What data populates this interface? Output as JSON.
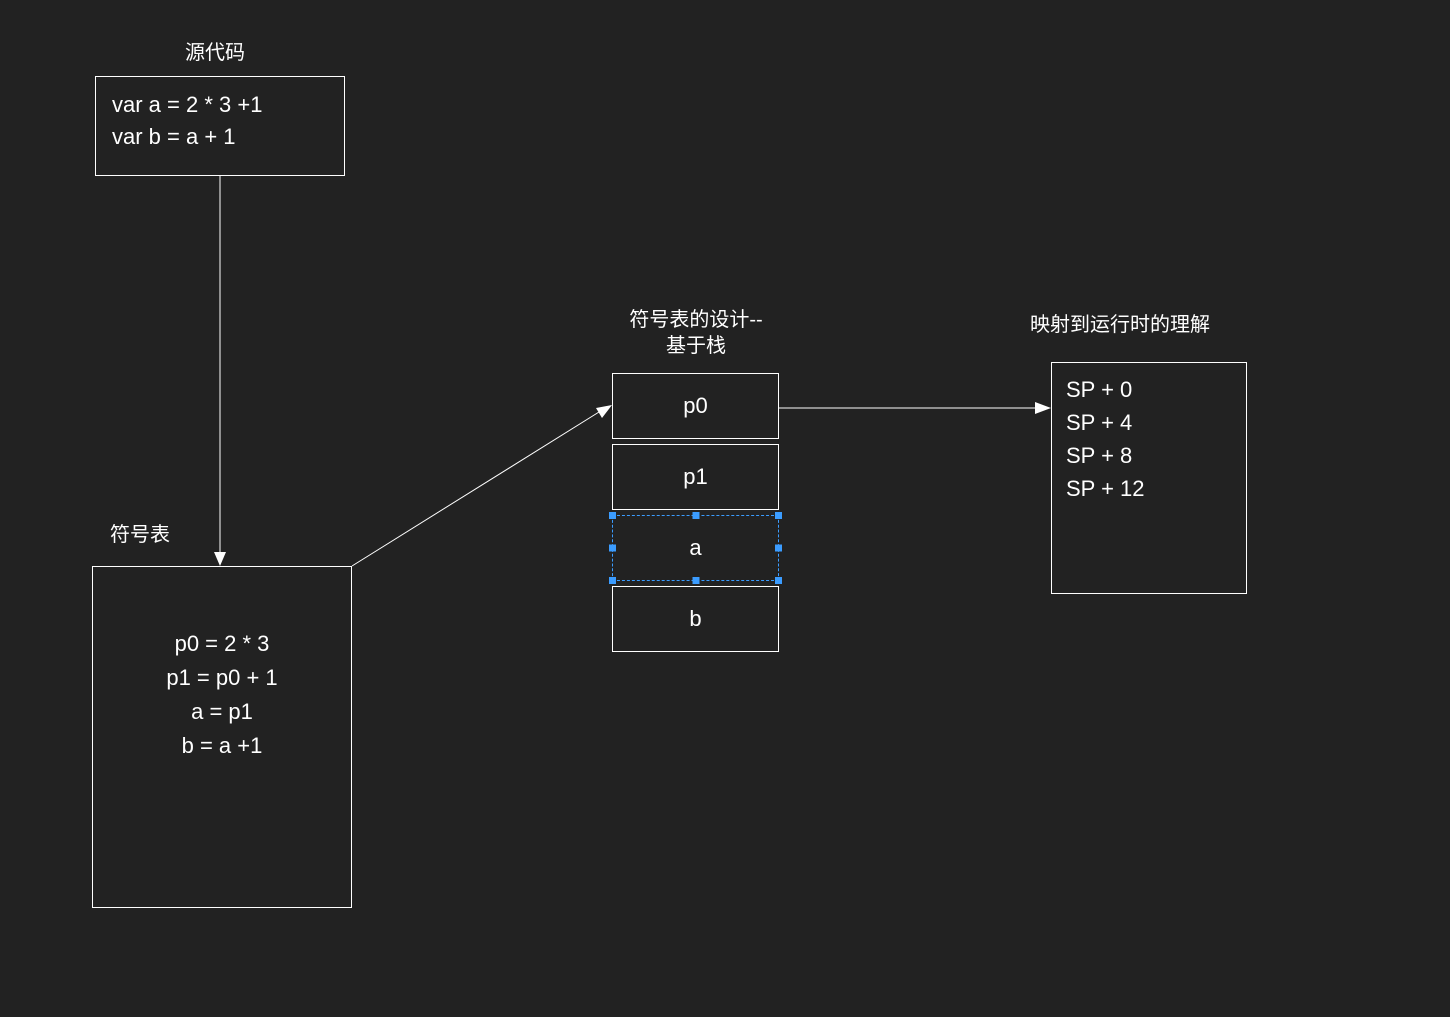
{
  "source": {
    "title": "源代码",
    "line1": "var a = 2 * 3 +1",
    "line2": "var b = a + 1"
  },
  "symtab": {
    "title": "符号表",
    "line1": "p0 = 2 * 3",
    "line2": "p1 = p0 + 1",
    "line3": "a = p1",
    "line4": "b = a +1"
  },
  "stack": {
    "title_line1": "符号表的设计--",
    "title_line2": "基于栈",
    "cells": {
      "c0": "p0",
      "c1": "p1",
      "c2": "a",
      "c3": "b"
    }
  },
  "runtime": {
    "title": "映射到运行时的理解",
    "line1": "SP + 0",
    "line2": "SP + 4",
    "line3": "SP + 8",
    "line4": "SP + 12"
  }
}
